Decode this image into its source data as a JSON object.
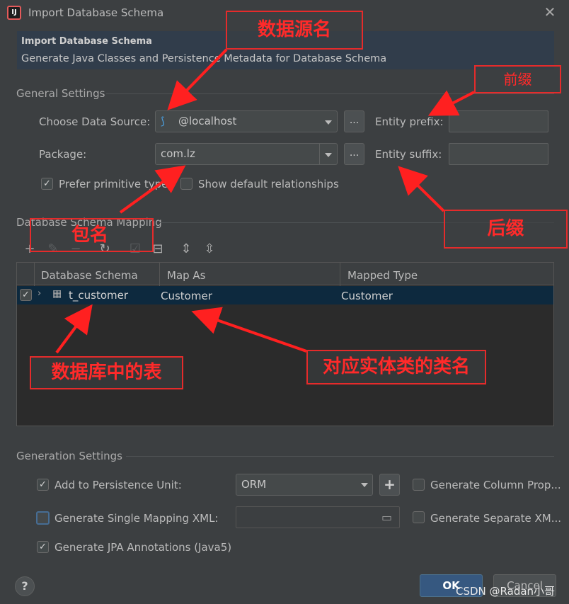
{
  "window": {
    "title": "Import Database Schema",
    "app_icon_text": "IJ"
  },
  "banner": {
    "title": "Import Database Schema",
    "subtitle": "Generate Java Classes and Persistence Metadata for Database Schema"
  },
  "general": {
    "heading": "General Settings",
    "data_source_label": "Choose Data Source:",
    "data_source_value": "@localhost",
    "package_label": "Package:",
    "package_value": "com.lz",
    "browse_label": "...",
    "entity_prefix_label": "Entity prefix:",
    "entity_prefix_value": "",
    "entity_suffix_label": "Entity suffix:",
    "entity_suffix_value": "",
    "prefer_primitive_label": "Prefer primitive types",
    "prefer_primitive_checked": true,
    "show_relationships_label": "Show default relationships",
    "show_relationships_checked": false
  },
  "mapping": {
    "heading": "Database Schema Mapping",
    "toolbar_icons": [
      "add-icon",
      "edit-icon",
      "remove-icon",
      "refresh-icon",
      "check-icon",
      "uncheck-icon",
      "expand-all-icon",
      "collapse-all-icon"
    ],
    "columns": [
      "Database Schema",
      "Map As",
      "Mapped Type"
    ],
    "rows": [
      {
        "checked": true,
        "schema": "t_customer",
        "map_as": "Customer",
        "mapped_type": "Customer"
      }
    ]
  },
  "generation": {
    "heading": "Generation Settings",
    "persistence_unit_label": "Add to Persistence Unit:",
    "persistence_unit_checked": true,
    "persistence_unit_value": "ORM",
    "add_button_label": "+",
    "column_props_label": "Generate Column Prop...",
    "column_props_checked": false,
    "single_xml_label": "Generate Single Mapping XML:",
    "single_xml_checked": false,
    "single_xml_value": "",
    "separate_xml_label": "Generate Separate XM...",
    "separate_xml_checked": false,
    "jpa_annotations_label": "Generate JPA Annotations (Java5)",
    "jpa_annotations_checked": true
  },
  "footer": {
    "help_label": "?",
    "ok_label": "OK",
    "cancel_label": "Cancel",
    "watermark": "CSDN @Radan小哥"
  },
  "annotations": {
    "data_source_name": "数据源名",
    "prefix": "前缀",
    "suffix": "后缀",
    "package_name": "包名",
    "db_table": "数据库中的表",
    "entity_class_name": "对应实体类的类名"
  },
  "colors": {
    "background": "#3c3f41",
    "banner": "#313d4b",
    "selection": "#0d293e",
    "ok_button": "#365880",
    "annotation_red": "#e52b2b"
  }
}
